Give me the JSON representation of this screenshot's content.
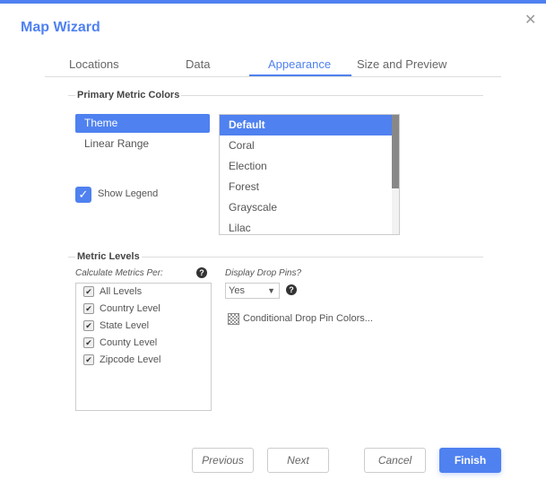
{
  "dialog": {
    "title": "Map Wizard",
    "close_icon": "close-icon"
  },
  "tabs": [
    {
      "label": "Locations"
    },
    {
      "label": "Data"
    },
    {
      "label": "Appearance",
      "active": true
    },
    {
      "label": "Size and Preview"
    }
  ],
  "primary_colors": {
    "section_label": "Primary Metric Colors",
    "modes": [
      {
        "label": "Theme",
        "selected": true
      },
      {
        "label": "Linear Range"
      }
    ],
    "show_legend": {
      "label": "Show Legend",
      "checked": true
    },
    "themes": [
      {
        "label": "Default",
        "selected": true
      },
      {
        "label": "Coral"
      },
      {
        "label": "Election"
      },
      {
        "label": "Forest"
      },
      {
        "label": "Grayscale"
      },
      {
        "label": "Lilac"
      }
    ]
  },
  "metric_levels": {
    "section_label": "Metric Levels",
    "calc_label": "Calculate Metrics Per:",
    "levels": [
      {
        "label": "All Levels",
        "checked": true
      },
      {
        "label": "Country Level",
        "checked": true
      },
      {
        "label": "State Level",
        "checked": true
      },
      {
        "label": "County Level",
        "checked": true
      },
      {
        "label": "Zipcode Level",
        "checked": true
      }
    ],
    "drop_pins_label": "Display Drop Pins?",
    "drop_pins_value": "Yes",
    "conditional_label": "Conditional Drop Pin Colors..."
  },
  "buttons": {
    "previous": "Previous",
    "next": "Next",
    "cancel": "Cancel",
    "finish": "Finish"
  },
  "colors": {
    "accent": "#4f81f0"
  }
}
